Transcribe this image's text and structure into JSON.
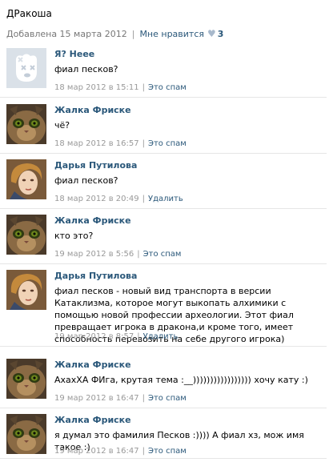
{
  "post": {
    "title": "ДРакоша",
    "added": "Добавлена 15 марта 2012",
    "like_label": "Мне нравится",
    "likes_count": "3"
  },
  "comments": [
    {
      "author": "Я? Неее",
      "text": "фиал песков?",
      "date": "18 мар 2012 в 15:11",
      "action": "Это спам",
      "avatar": "deleted-user"
    },
    {
      "author": "Жалка Фриске",
      "text": "чё?",
      "date": "18 мар 2012 в 16:57",
      "action": "Это спам",
      "avatar": "cat"
    },
    {
      "author": "Дарья Путилова",
      "text": "фиал песков?",
      "date": "18 мар 2012 в 20:49",
      "action": "Удалить",
      "avatar": "woman"
    },
    {
      "author": "Жалка Фриске",
      "text": "кто это?",
      "date": "19 мар 2012 в 5:56",
      "action": "Это спам",
      "avatar": "cat"
    },
    {
      "author": "Дарья Путилова",
      "text": "фиал песков - новый вид транспорта в версии Катаклизма, которое могут выкопать алхимики с помощью новой профессии археологии. Этот фиал превращает игрока в дракона,и кроме того, имеет способность перевозить на себе другого игрока)",
      "date": "19 мар 2012 в 8:57",
      "action": "Удалить",
      "avatar": "woman"
    },
    {
      "author": "Жалка Фриске",
      "text": "АхахХА ФИга, крутая тема :__))))))))))))))))) хочу кату :)",
      "date": "19 мар 2012 в 16:47",
      "action": "Это спам",
      "avatar": "cat"
    },
    {
      "author": "Жалка Фриске",
      "text": "я думал это фамилия Песков :)))) А фиал хз, мож имя такое :)",
      "date": "19 мар 2012 в 16:47",
      "action": "Это спам",
      "avatar": "cat"
    }
  ],
  "colors": {
    "link": "#2b587a",
    "muted": "#999999",
    "divider": "#e6e6e6",
    "heart": "#a8b9cc"
  }
}
